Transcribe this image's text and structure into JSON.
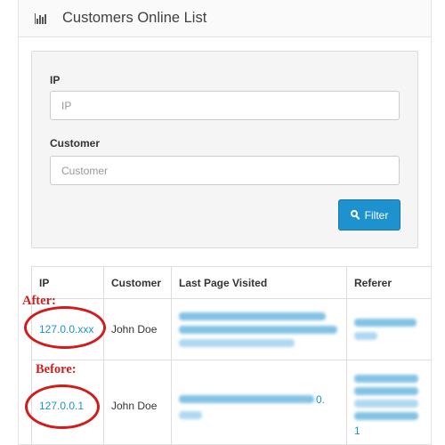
{
  "header": {
    "icon": "bar-chart-icon",
    "title": "Customers Online List"
  },
  "filter": {
    "ip_label": "IP",
    "ip_placeholder": "IP",
    "customer_label": "Customer",
    "customer_placeholder": "Customer",
    "button_label": "Filter",
    "button_icon": "search-icon",
    "button_color": "#1e91cf"
  },
  "table": {
    "columns": [
      "IP",
      "Customer",
      "Last Page Visited",
      "Referer"
    ],
    "rows": [
      {
        "ip": "127.0.0.xxx",
        "customer": "John Doe",
        "referer_tail": ""
      },
      {
        "ip": "127.0.0.1",
        "customer": "John Doe",
        "last_page_tail": "0.",
        "referer_tail": "1"
      }
    ]
  },
  "annotations": {
    "after_label": "After:",
    "before_label": "Before:",
    "color": "#cc1f1f"
  }
}
